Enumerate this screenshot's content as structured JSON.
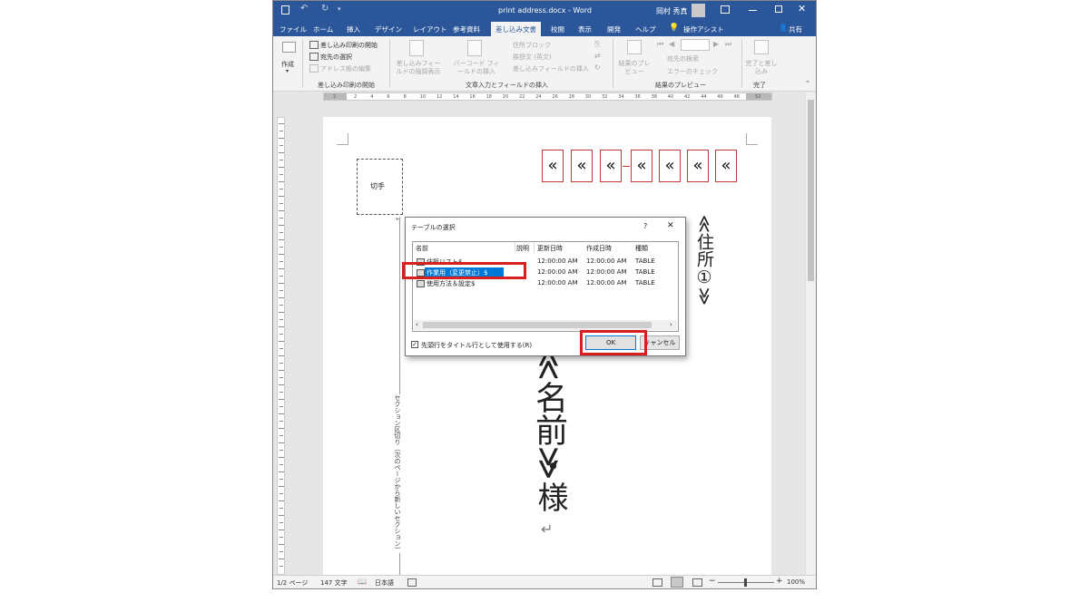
{
  "window": {
    "title": "print address.docx - Word",
    "user": "岡村 秀真"
  },
  "tabs": [
    "ファイル",
    "ホーム",
    "挿入",
    "デザイン",
    "レイアウト",
    "参考資料",
    "差し込み文書",
    "校閲",
    "表示",
    "開発",
    "ヘルプ",
    "操作アシスト",
    "共有"
  ],
  "ribbon": {
    "create": "作成",
    "start_merge": "差し込み印刷の開始",
    "select_recipients": "宛先の選択",
    "edit_list": "アドレス帳の編集",
    "group1": "差し込み印刷の開始",
    "highlight_fields": "差し込みフィールドの強調表示",
    "barcode_field": "バーコード フィールドの挿入",
    "address_block": "住所ブロック",
    "greeting_line": "挨拶文 (英文)",
    "insert_merge_field": "差し込みフィールドの挿入",
    "group2": "文章入力とフィールドの挿入",
    "preview": "結果のプレビュー",
    "find_recipient": "宛先の検索",
    "check_errors": "エラーのチェック",
    "group3": "結果のプレビュー",
    "finish_merge": "完了と差し込み",
    "group4": "完了"
  },
  "ruler": {
    "left_label": "2",
    "ticks": [
      "2",
      "4",
      "6",
      "8",
      "10",
      "12",
      "14",
      "16",
      "18",
      "20",
      "22",
      "24",
      "26",
      "28",
      "30",
      "32",
      "34",
      "36",
      "38",
      "40",
      "42",
      "44",
      "46",
      "48"
    ],
    "right_label": "52"
  },
  "document": {
    "stamp": "切手",
    "address_field": "≪住所①≫",
    "name_field": "≪名前≫",
    "sama": "・様",
    "section_break": "セクション区切り（次のページから新しいセクション）",
    "guillemet": "«"
  },
  "dialog": {
    "title": "テーブルの選択",
    "help": "?",
    "close": "✕",
    "columns": [
      "名前",
      "説明",
      "更新日時",
      "作成日時",
      "種類"
    ],
    "rows": [
      {
        "name": "住所リスト$",
        "updated": "12:00:00 AM",
        "created": "12:00:00 AM",
        "type": "TABLE"
      },
      {
        "name": "作業用（変更禁止）$",
        "updated": "12:00:00 AM",
        "created": "12:00:00 AM",
        "type": "TABLE"
      },
      {
        "name": "使用方法＆設定$",
        "updated": "12:00:00 AM",
        "created": "12:00:00 AM",
        "type": "TABLE"
      }
    ],
    "checkbox_label": "先頭行をタイトル行として使用する(R)",
    "ok": "OK",
    "cancel": "キャンセル"
  },
  "status": {
    "page": "1/2 ページ",
    "words": "147 文字",
    "lang": "日本語",
    "zoom": "100%"
  },
  "colors": {
    "word_blue": "#2b579a",
    "highlight_red": "#d81e1e",
    "selection_blue": "#0078d7"
  }
}
